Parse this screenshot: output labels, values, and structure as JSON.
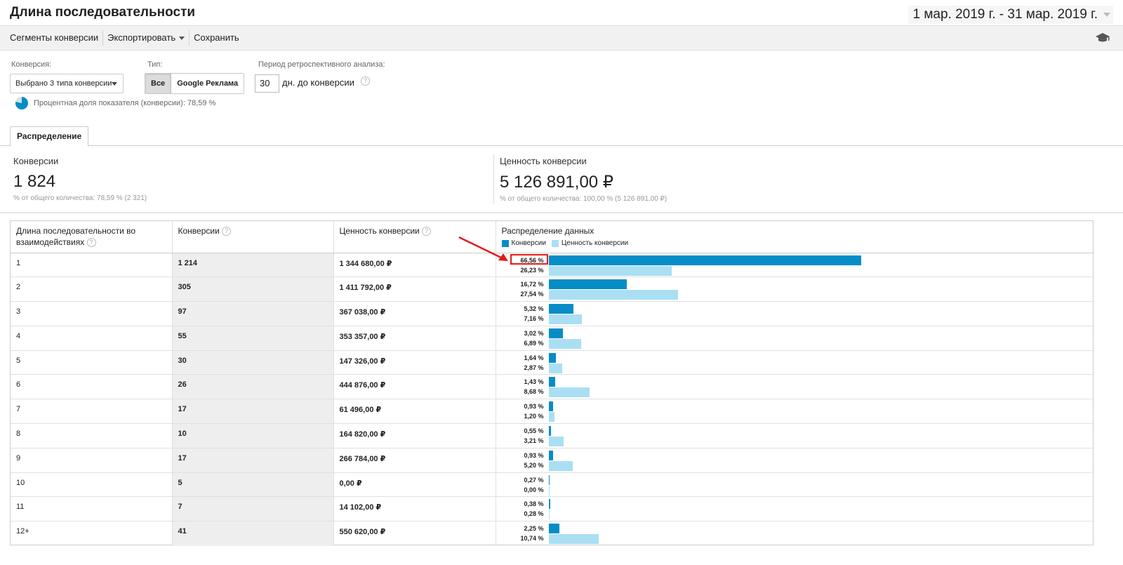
{
  "header": {
    "title": "Длина последовательности",
    "date_range": "1 мар. 2019 г. - 31 мар. 2019 г."
  },
  "toolbar": {
    "segments": "Сегменты конверсии",
    "export": "Экспортировать",
    "save": "Сохранить",
    "icon": "graduation-cap-icon"
  },
  "controls": {
    "conversion_label": "Конверсия:",
    "conversion_value": "Выбрано 3 типа конверсии",
    "type_label": "Тип:",
    "type_all": "Все",
    "type_google": "Google Реклама",
    "lookback_label": "Период ретроспективного анализа:",
    "lookback_days": "30",
    "lookback_suffix": "дн. до конверсии",
    "help": "?",
    "share_text": "Процентная доля показателя (конверсии): 78,59 %",
    "share_fraction": 0.7859
  },
  "tabs": {
    "distribution": "Распределение"
  },
  "summary": {
    "conversions_label": "Конверсии",
    "conversions_value": "1 824",
    "conversions_sub": "% от общего количества: 78,59 % (2 321)",
    "value_label": "Ценность конверсии",
    "value_value": "5 126 891,00 ₽",
    "value_sub": "% от общего количества: 100,00 % (5 126 891,00 ₽)"
  },
  "table": {
    "headers": {
      "length": "Длина последовательности во взаимодействиях",
      "conversions": "Конверсии",
      "value": "Ценность конверсии",
      "distribution": "Распределение данных"
    },
    "legend": {
      "conversions": "Конверсии",
      "value": "Ценность конверсии"
    },
    "colors": {
      "conversions": "#058dc7",
      "value": "#aadff3"
    },
    "rows": [
      {
        "length": "1",
        "conversions": "1 214",
        "value": "1 344 680,00 ₽",
        "conv_pct": "66,56 %",
        "val_pct": "26,23 %",
        "conv_share": 66.56,
        "val_share": 26.23
      },
      {
        "length": "2",
        "conversions": "305",
        "value": "1 411 792,00 ₽",
        "conv_pct": "16,72 %",
        "val_pct": "27,54 %",
        "conv_share": 16.72,
        "val_share": 27.54
      },
      {
        "length": "3",
        "conversions": "97",
        "value": "367 038,00 ₽",
        "conv_pct": "5,32 %",
        "val_pct": "7,16 %",
        "conv_share": 5.32,
        "val_share": 7.16
      },
      {
        "length": "4",
        "conversions": "55",
        "value": "353 357,00 ₽",
        "conv_pct": "3,02 %",
        "val_pct": "6,89 %",
        "conv_share": 3.02,
        "val_share": 6.89
      },
      {
        "length": "5",
        "conversions": "30",
        "value": "147 326,00 ₽",
        "conv_pct": "1,64 %",
        "val_pct": "2,87 %",
        "conv_share": 1.64,
        "val_share": 2.87
      },
      {
        "length": "6",
        "conversions": "26",
        "value": "444 876,00 ₽",
        "conv_pct": "1,43 %",
        "val_pct": "8,68 %",
        "conv_share": 1.43,
        "val_share": 8.68
      },
      {
        "length": "7",
        "conversions": "17",
        "value": "61 496,00 ₽",
        "conv_pct": "0,93 %",
        "val_pct": "1,20 %",
        "conv_share": 0.93,
        "val_share": 1.2
      },
      {
        "length": "8",
        "conversions": "10",
        "value": "164 820,00 ₽",
        "conv_pct": "0,55 %",
        "val_pct": "3,21 %",
        "conv_share": 0.55,
        "val_share": 3.21
      },
      {
        "length": "9",
        "conversions": "17",
        "value": "266 784,00 ₽",
        "conv_pct": "0,93 %",
        "val_pct": "5,20 %",
        "conv_share": 0.93,
        "val_share": 5.2
      },
      {
        "length": "10",
        "conversions": "5",
        "value": "0,00 ₽",
        "conv_pct": "0,27 %",
        "val_pct": "0,00 %",
        "conv_share": 0.27,
        "val_share": 0.0
      },
      {
        "length": "11",
        "conversions": "7",
        "value": "14 102,00 ₽",
        "conv_pct": "0,38 %",
        "val_pct": "0,28 %",
        "conv_share": 0.38,
        "val_share": 0.28
      },
      {
        "length": "12+",
        "conversions": "41",
        "value": "550 620,00 ₽",
        "conv_pct": "2,25 %",
        "val_pct": "10,74 %",
        "conv_share": 2.25,
        "val_share": 10.74
      }
    ]
  }
}
